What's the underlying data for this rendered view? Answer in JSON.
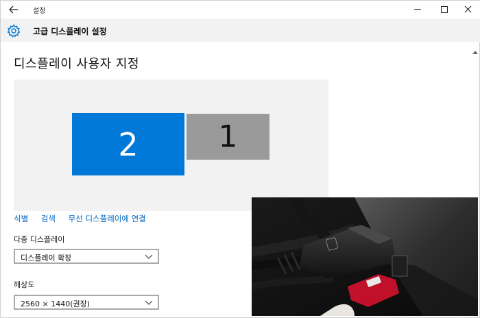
{
  "window": {
    "title": "설정",
    "header_title": "고급 디스플레이 설정"
  },
  "page": {
    "title": "디스플레이 사용자 지정"
  },
  "arrangement": {
    "monitors": [
      {
        "label": "2",
        "selected": true
      },
      {
        "label": "1",
        "selected": false
      }
    ]
  },
  "links": {
    "identify": "식별",
    "detect": "검색",
    "wireless": "무선 디스플레이에 연결"
  },
  "multi_display": {
    "label": "다중 디스플레이",
    "value": "디스플레이 확장"
  },
  "resolution": {
    "label": "해상도",
    "value": "2560 × 1440(권장)"
  },
  "colors": {
    "accent": "#0078d7",
    "link": "#0067c0"
  }
}
